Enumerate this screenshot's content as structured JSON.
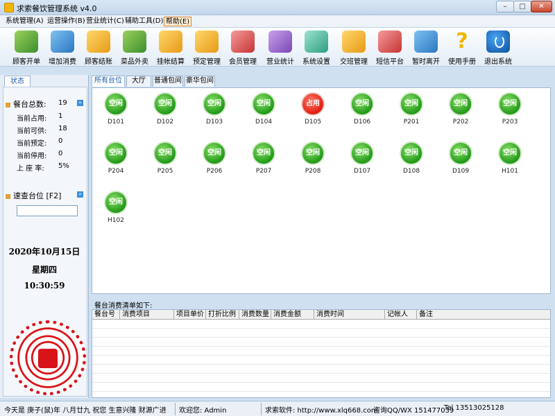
{
  "window": {
    "title": "求索餐饮管理系统 v4.0",
    "min": "–",
    "max": "□",
    "close": "✕"
  },
  "menu": [
    {
      "label": "系统管理(A)"
    },
    {
      "label": "运营操作(B)"
    },
    {
      "label": "营业统计(C)"
    },
    {
      "label": "辅助工具(D)"
    },
    {
      "label": "帮助(E)"
    }
  ],
  "toolbar": [
    {
      "label": "顾客开单",
      "icon": "open-order-icon"
    },
    {
      "label": "增加消费",
      "icon": "add-consume-icon"
    },
    {
      "label": "顾客结账",
      "icon": "checkout-icon"
    },
    {
      "label": "菜品外卖",
      "icon": "takeout-icon"
    },
    {
      "label": "挂帐结算",
      "icon": "credit-settle-icon"
    },
    {
      "label": "预定管理",
      "icon": "reservation-icon"
    },
    {
      "label": "会员管理",
      "icon": "member-icon"
    },
    {
      "label": "营业统计",
      "icon": "stats-icon"
    },
    {
      "label": "系统设置",
      "icon": "settings-icon"
    },
    {
      "label": "交班管理",
      "icon": "shift-icon"
    },
    {
      "label": "短信平台",
      "icon": "sms-icon"
    },
    {
      "label": "暂时离开",
      "icon": "away-icon"
    },
    {
      "label": "使用手册",
      "icon": "help-icon"
    },
    {
      "label": "退出系统",
      "icon": "power-icon"
    }
  ],
  "left": {
    "tab": "状态",
    "total_label": "餐台总数:",
    "total_value": "19",
    "rows": [
      {
        "label": "当前占用:",
        "value": "1"
      },
      {
        "label": "当前可供:",
        "value": "18"
      },
      {
        "label": "当前预定:",
        "value": "0"
      },
      {
        "label": "当前停用:",
        "value": "0"
      },
      {
        "label": "上 座 率:",
        "value": "5%"
      }
    ],
    "quick_label": "速查台位 [F2]",
    "date": "2020年10月15日",
    "weekday": "星期四",
    "time": "10:30:59"
  },
  "tabs": [
    "所有台位",
    "大厅",
    "普通包间",
    "豪华包间"
  ],
  "tables": [
    {
      "code": "D101",
      "status": "空闲"
    },
    {
      "code": "D102",
      "status": "空闲"
    },
    {
      "code": "D103",
      "status": "空闲"
    },
    {
      "code": "D104",
      "status": "空闲"
    },
    {
      "code": "D105",
      "status": "占用"
    },
    {
      "code": "D106",
      "status": "空闲"
    },
    {
      "code": "P201",
      "status": "空闲"
    },
    {
      "code": "P202",
      "status": "空闲"
    },
    {
      "code": "P203",
      "status": "空闲"
    },
    {
      "code": "P204",
      "status": "空闲"
    },
    {
      "code": "P205",
      "status": "空闲"
    },
    {
      "code": "P206",
      "status": "空闲"
    },
    {
      "code": "P207",
      "status": "空闲"
    },
    {
      "code": "P208",
      "status": "空闲"
    },
    {
      "code": "D107",
      "status": "空闲"
    },
    {
      "code": "D108",
      "status": "空闲"
    },
    {
      "code": "D109",
      "status": "空闲"
    },
    {
      "code": "H101",
      "status": "空闲"
    },
    {
      "code": "H102",
      "status": "空闲"
    }
  ],
  "consume": {
    "label": "餐台消费清单如下:",
    "columns": [
      "餐台号",
      "消费项目",
      "项目单价",
      "打折比例",
      "消费数量",
      "消费金额",
      "消费时间",
      "记帐人",
      "备注"
    ]
  },
  "status": {
    "today": "今天是 庚子(鼠)年 八月廿九 祝您 生意兴隆 财源广进",
    "welcome": "欢迎您: Admin",
    "software": "求索软件: http://www.xlq668.com",
    "contact": "咨询QQ/WX 151477039",
    "tel": "Tel 13513025128"
  }
}
